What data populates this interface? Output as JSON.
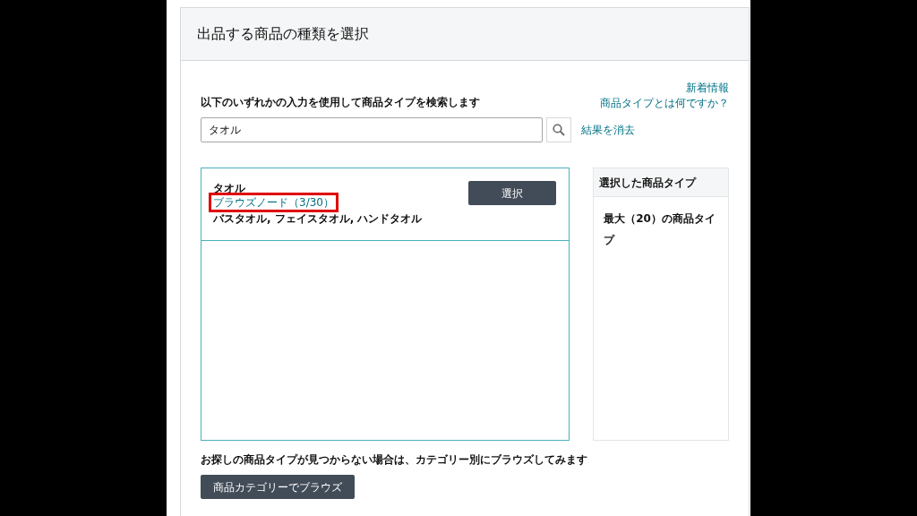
{
  "header": {
    "title": "出品する商品の種類を選択"
  },
  "links": [
    "新着情報",
    "商品タイプとは何ですか？"
  ],
  "instruction": "以下のいずれかの入力を使用して商品タイプを検索します",
  "search": {
    "value": "タオル",
    "clear_link": "結果を消去"
  },
  "results": [
    {
      "name": "タオル",
      "browse_node": "ブラウズノード（3/30）",
      "highlighted": true,
      "path": "バスタオル, フェイスタオル, ハンドタオル",
      "button": "選択"
    }
  ],
  "selected_panel": {
    "title": "選択した商品タイプ",
    "note": "最大（20）の商品タイプ"
  },
  "footer": {
    "text": "お探しの商品タイプが見つからない場合は、カテゴリー別にブラウズしてみます",
    "button": "商品カテゴリーでブラウズ"
  }
}
